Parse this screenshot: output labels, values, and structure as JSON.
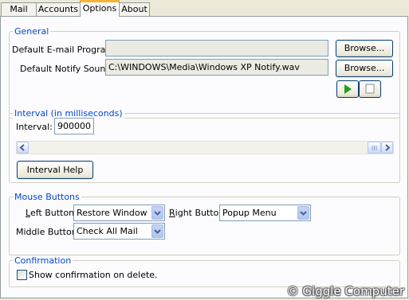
{
  "tabs": [
    {
      "label": "Mail"
    },
    {
      "label": "Accounts"
    },
    {
      "label": "Options",
      "active": true
    },
    {
      "label": "About"
    }
  ],
  "general": {
    "legend": "General",
    "email_program_label": "Default E-mail Program:",
    "email_program_value": "",
    "notify_sound_label": "Default Notify Sound:",
    "notify_sound_value": "C:\\WINDOWS\\Media\\Windows XP Notify.wav",
    "browse_label": "Browse...",
    "play_icon": "play-icon",
    "stop_icon": "stop-icon"
  },
  "interval": {
    "legend": "Interval (in milliseconds)",
    "label": "Interval:",
    "value": "900000",
    "help_label": "Interval Help"
  },
  "mouse": {
    "legend": "Mouse Buttons",
    "left_label_ul": "L",
    "left_label_rest": "eft Button:",
    "left_value": "Restore Window",
    "right_label_ul": "R",
    "right_label_rest": "ight Button:",
    "right_value": "Popup Menu",
    "middle_label": "Middle Button:",
    "middle_value": "Check All Mail"
  },
  "confirmation": {
    "legend": "Confirmation",
    "checkbox_label": "Show confirmation on delete.",
    "checked": false
  },
  "watermark": "© Giggle Computer",
  "colors": {
    "window_bg": "#ece9d8",
    "panel_bg": "#fcfcfe",
    "legend_text": "#0046d5",
    "play_green": "#1ea01e",
    "active_tab_accent": "#f8b333"
  }
}
